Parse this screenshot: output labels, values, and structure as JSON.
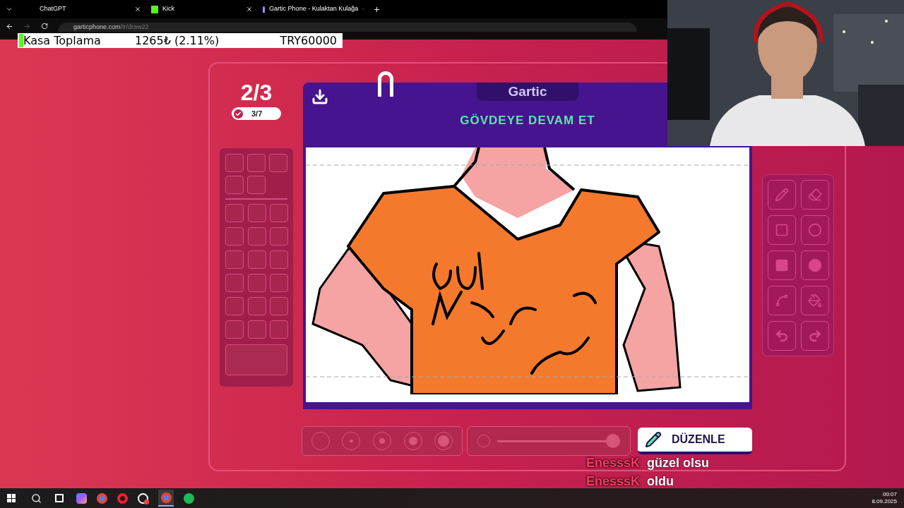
{
  "browser": {
    "tabs": [
      {
        "label": "ChatGPT"
      },
      {
        "label": "Kick"
      },
      {
        "label": "Gartic Phone - Kulaktan Kulağa"
      }
    ],
    "url_host": "garticphone.com",
    "url_path": "/tr/draw22"
  },
  "overlay": {
    "label": "Kasa Toplama",
    "amount": "1265₺ (2.11%)",
    "target": "TRY60000"
  },
  "game": {
    "round": "2/3",
    "done": "3/7",
    "logo": "Gartic",
    "instruction": "GÖVDEYE DEVAM ET",
    "opacity_slider": {
      "level": 1
    },
    "button": "DÜZENLE"
  },
  "chat": [
    {
      "user": "EnesssK",
      "message": "güzel olsu"
    },
    {
      "user": "EnesssK",
      "message": "oldu"
    }
  ],
  "clock": {
    "time": "00:07",
    "date": "8.09.2025"
  }
}
